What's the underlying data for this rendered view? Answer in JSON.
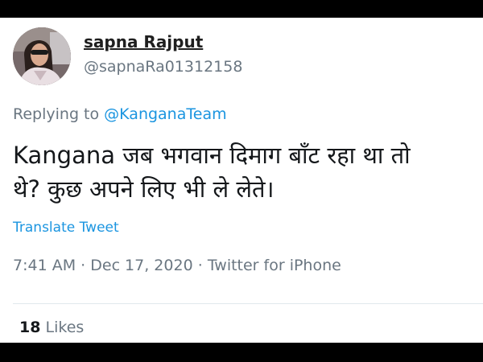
{
  "user": {
    "display_name": "sapna Rajput",
    "handle": "@sapnaRa01312158"
  },
  "reply": {
    "prefix": "Replying to",
    "mention": "@KanganaTeam"
  },
  "tweet": {
    "line1": "Kangana जब भगवान दिमाग बाँट रहा था तो",
    "line2": "थे? कुछ अपने लिए भी ले लेते।"
  },
  "translate_label": "Translate Tweet",
  "meta": {
    "time": "7:41 AM",
    "date": "Dec 17, 2020",
    "source": "Twitter for iPhone",
    "separator": "·"
  },
  "likes": {
    "count": "18",
    "label": "Likes"
  },
  "colors": {
    "link": "#1b95e0",
    "muted": "#6a7681",
    "text": "#14171a",
    "letterbox": "#000000"
  },
  "icons": {
    "avatar": "user-avatar-photo"
  }
}
